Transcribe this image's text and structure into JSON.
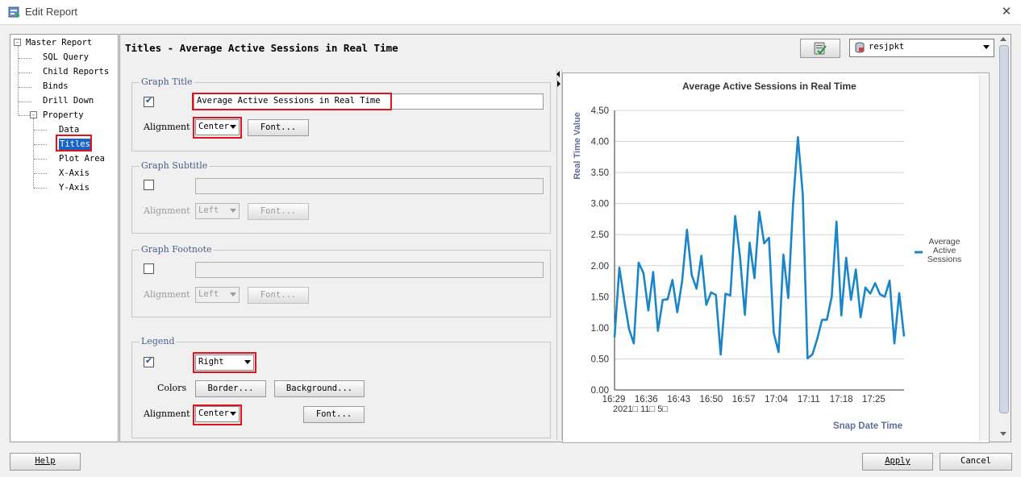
{
  "window": {
    "title": "Edit Report",
    "close_glyph": "✕"
  },
  "tree": {
    "root": "Master Report",
    "items": [
      "SQL Query",
      "Child Reports",
      "Binds",
      "Drill Down"
    ],
    "property": "Property",
    "property_children": [
      "Data",
      "Titles",
      "Plot Area",
      "X-Axis",
      "Y-Axis"
    ],
    "expand_glyph": "-"
  },
  "panel": {
    "title": "Titles - Average Active Sessions in Real Time"
  },
  "connection": {
    "selected": "resjpkt"
  },
  "graph_title": {
    "group_label": "Graph Title",
    "checked": true,
    "value": "Average Active Sessions in Real Time",
    "alignment_label": "Alignment",
    "alignment": "Center",
    "font_button": "Font..."
  },
  "graph_subtitle": {
    "group_label": "Graph Subtitle",
    "checked": false,
    "value": "",
    "alignment_label": "Alignment",
    "alignment": "Left",
    "font_button": "Font..."
  },
  "graph_footnote": {
    "group_label": "Graph Footnote",
    "checked": false,
    "value": "",
    "alignment_label": "Alignment",
    "alignment": "Left",
    "font_button": "Font..."
  },
  "legend": {
    "group_label": "Legend",
    "checked": true,
    "position": "Right",
    "colors_label": "Colors",
    "border_button": "Border...",
    "background_button": "Background...",
    "alignment_label": "Alignment",
    "alignment": "Center",
    "font_button": "Font..."
  },
  "buttons": {
    "help": "Help",
    "apply": "Apply",
    "cancel": "Cancel"
  },
  "chart_data": {
    "type": "line",
    "title": "Average Active Sessions in Real Time",
    "ylabel": "Real Time Value",
    "xlabel": "Snap Date Time",
    "date_label": "2021□ 11□ 5□",
    "ylim": [
      0,
      4.5
    ],
    "yticks": [
      "0.00",
      "0.50",
      "1.00",
      "1.50",
      "2.00",
      "2.50",
      "3.00",
      "3.50",
      "4.00",
      "4.50"
    ],
    "xticks": [
      "16:29",
      "16:36",
      "16:43",
      "16:50",
      "16:57",
      "17:04",
      "17:11",
      "17:18",
      "17:25"
    ],
    "grid": true,
    "legend_position": "right",
    "series": [
      {
        "name": "Average Active Sessions",
        "color": "#1a86c8",
        "values": [
          0.85,
          1.97,
          1.45,
          0.98,
          0.75,
          2.05,
          1.88,
          1.28,
          1.9,
          0.95,
          1.45,
          1.46,
          1.77,
          1.25,
          1.75,
          2.58,
          1.85,
          1.63,
          2.16,
          1.37,
          1.57,
          1.53,
          0.57,
          1.55,
          1.52,
          2.8,
          2.14,
          1.21,
          2.37,
          1.8,
          2.87,
          2.36,
          2.45,
          0.92,
          0.61,
          2.18,
          1.48,
          3.0,
          4.07,
          3.15,
          0.51,
          0.57,
          0.82,
          1.13,
          1.13,
          1.5,
          2.71,
          1.2,
          2.13,
          1.45,
          1.94,
          1.17,
          1.65,
          1.55,
          1.72,
          1.54,
          1.5,
          1.76,
          0.75,
          1.56,
          0.86
        ]
      }
    ]
  }
}
